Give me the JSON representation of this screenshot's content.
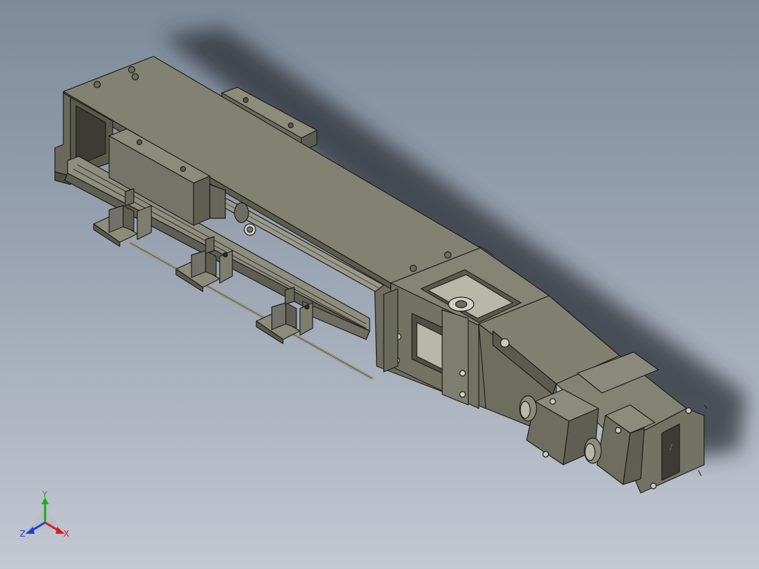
{
  "viewport": {
    "background_top": "#7e8a9a",
    "background_bottom": "#c3c8d2"
  },
  "model": {
    "part_color": "#7a7a6a",
    "part_dark": "#55554a",
    "part_light": "#8c8c7c",
    "edge_color": "#1e1e1a"
  },
  "triad": {
    "x_label": "X",
    "y_label": "Y",
    "z_label": "Z",
    "x_color": "#d42020",
    "y_color": "#18b018",
    "z_color": "#2040d0"
  }
}
